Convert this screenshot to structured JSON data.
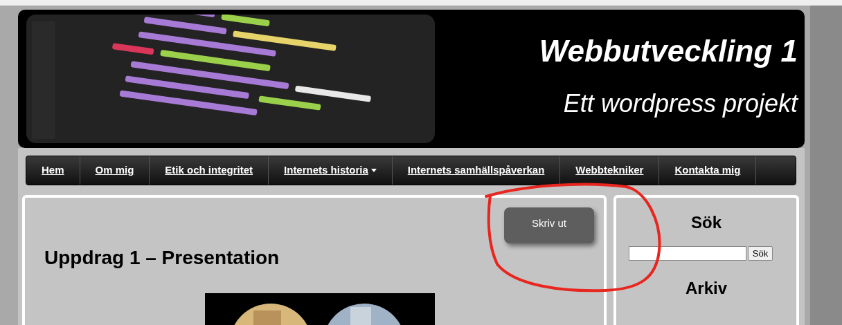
{
  "header": {
    "title": "Webbutveckling 1",
    "subtitle": "Ett wordpress projekt"
  },
  "nav": [
    {
      "label": "Hem",
      "dropdown": false
    },
    {
      "label": "Om mig",
      "dropdown": false
    },
    {
      "label": "Etik och integritet",
      "dropdown": false
    },
    {
      "label": "Internets historia",
      "dropdown": true
    },
    {
      "label": "Internets samhällspåverkan",
      "dropdown": false
    },
    {
      "label": "Webbtekniker",
      "dropdown": false
    },
    {
      "label": "Kontakta mig",
      "dropdown": false
    }
  ],
  "content": {
    "print_button": "Skriv ut",
    "heading": "Uppdrag 1 – Presentation"
  },
  "sidebar": {
    "search_title": "Sök",
    "search_button": "Sök",
    "archive_title": "Arkiv"
  }
}
